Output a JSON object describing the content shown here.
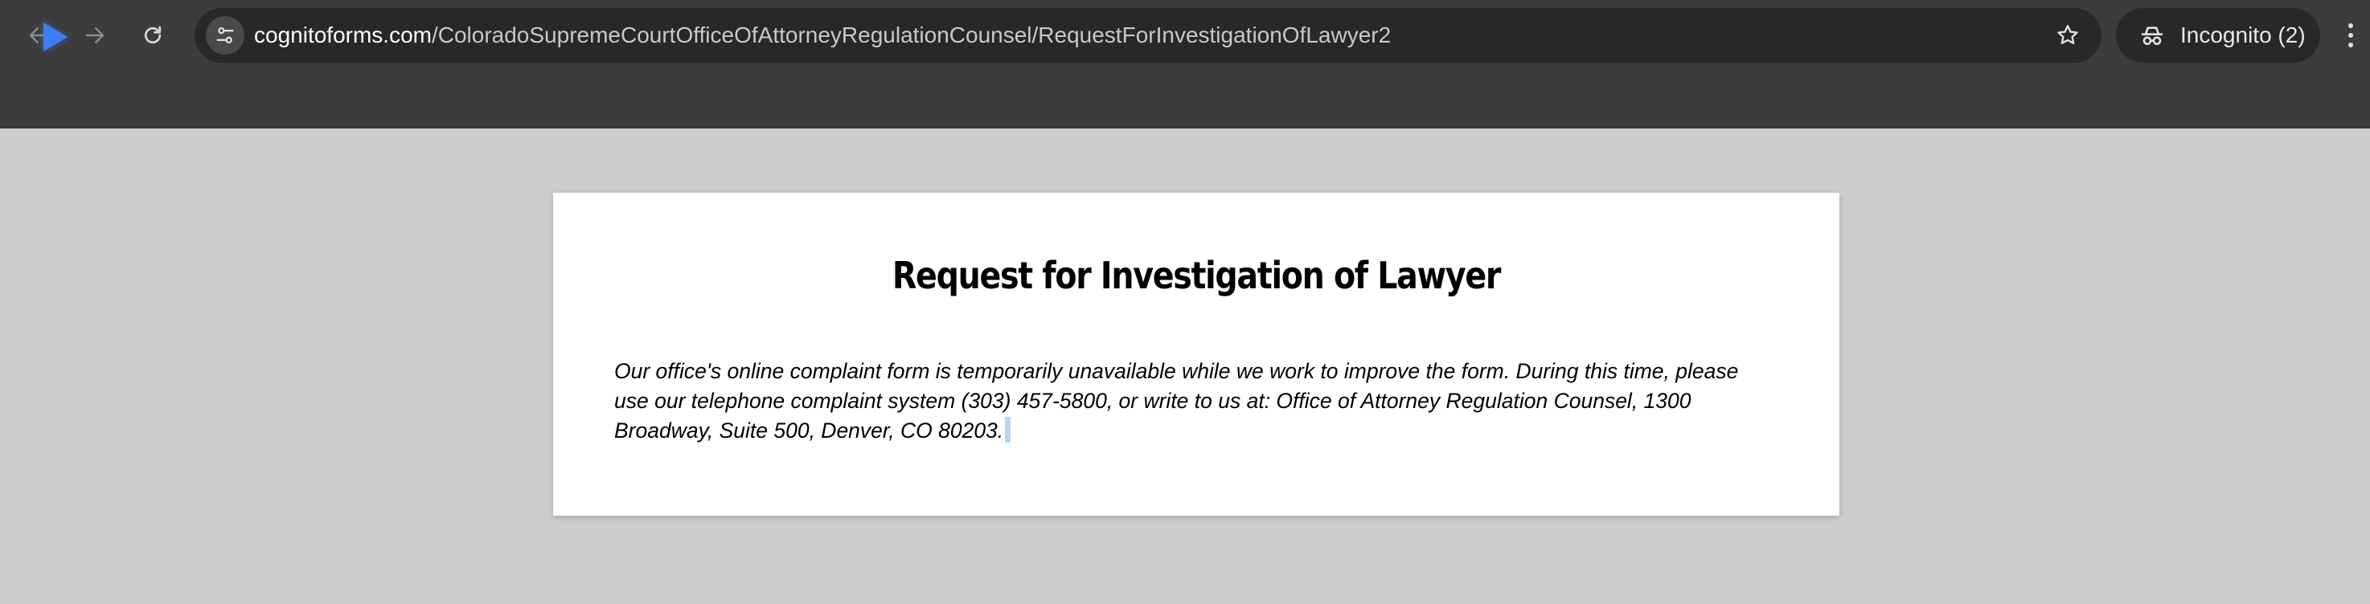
{
  "browser": {
    "url_domain": "cognitoforms.com",
    "url_path": "/ColoradoSupremeCourtOfficeOfAttorneyRegulationCounsel/RequestForInvestigationOfLawyer2",
    "incognito_label": "Incognito (2)",
    "icons": {
      "back": "arrow-left-icon",
      "forward": "arrow-right-icon",
      "reload": "reload-icon",
      "site_info": "tune-icon",
      "bookmark": "star-icon",
      "incognito": "incognito-icon",
      "menu": "more-vert-icon"
    }
  },
  "page": {
    "title": "Request for Investigation of Lawyer",
    "message": "Our office's online complaint form is temporarily unavailable while we work to improve the form. During this time, please use our telephone complaint system (303) 457-5800, or write to us at: Office of Attorney Regulation Counsel, 1300 Broadway, Suite 500, Denver, CO 80203."
  },
  "colors": {
    "chrome_bg": "#3c3c3c",
    "omnibox_bg": "#282828",
    "page_bg": "#cccccc",
    "card_bg": "#ffffff",
    "cursor": "#3f7ef2"
  }
}
